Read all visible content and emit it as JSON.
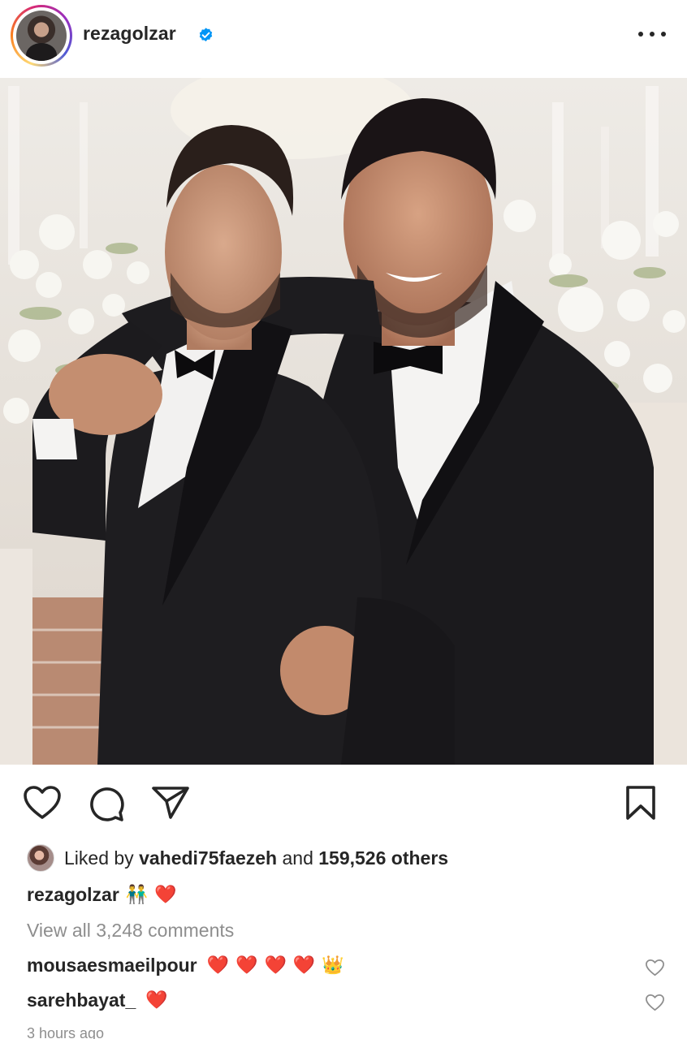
{
  "post": {
    "author": "rezagolzar",
    "verified": true,
    "more_icon": "more-horizontal-icon",
    "photo_alt": "two-men-tuxedo-photo"
  },
  "actions": {
    "like_icon": "heart-icon",
    "comment_icon": "comment-icon",
    "share_icon": "send-icon",
    "save_icon": "bookmark-icon"
  },
  "likes": {
    "prefix": "Liked by ",
    "user": "vahedi75faezeh",
    "middle": " and ",
    "count": "159,526 others"
  },
  "caption": {
    "user": "rezagolzar",
    "emojis": [
      "👬",
      "❤️"
    ]
  },
  "view_all_comments": "View all 3,248 comments",
  "comments": [
    {
      "user": "mousaesmaeilpour",
      "text_emojis": [
        "❤️",
        "❤️",
        "❤️",
        "❤️",
        "👑"
      ]
    },
    {
      "user": "sarehbayat_",
      "text_emojis": [
        "❤️"
      ]
    }
  ],
  "timestamp": "3 hours ago",
  "colors": {
    "text": "#262626",
    "secondary": "#8e8e8e",
    "verified_blue": "#0095f6",
    "heart_red": "#e02027"
  }
}
